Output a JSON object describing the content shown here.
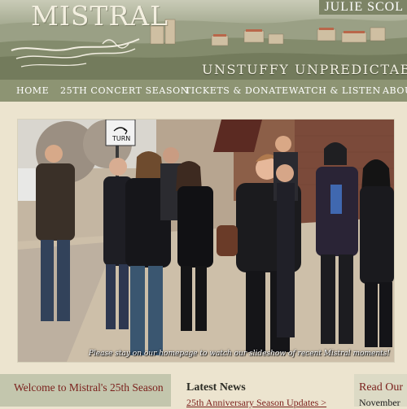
{
  "header": {
    "logo_text": "MISTRAL",
    "name": "JULIE SCOL",
    "tagline": "UNSTUFFY  UNPREDICTABL"
  },
  "nav": {
    "items": [
      {
        "label": "HOME"
      },
      {
        "label": "25TH CONCERT SEASON"
      },
      {
        "label": "TICKETS & DONATE"
      },
      {
        "label": "WATCH & LISTEN"
      },
      {
        "label": "ABOU"
      }
    ]
  },
  "slideshow": {
    "caption": "Please stay on our homepage to watch our slideshow of  recent Mistral moments!",
    "sign_text": "TURN"
  },
  "welcome": {
    "title": "Welcome to Mistral's 25th Season"
  },
  "news": {
    "title": "Latest News",
    "link": "25th Anniversary Season Updates >"
  },
  "read": {
    "title": "Read Our",
    "subtitle": "November"
  },
  "colors": {
    "nav_bg": "#8d9473",
    "accent_red": "#7a1f1b",
    "page_bg": "#ece4cf"
  }
}
